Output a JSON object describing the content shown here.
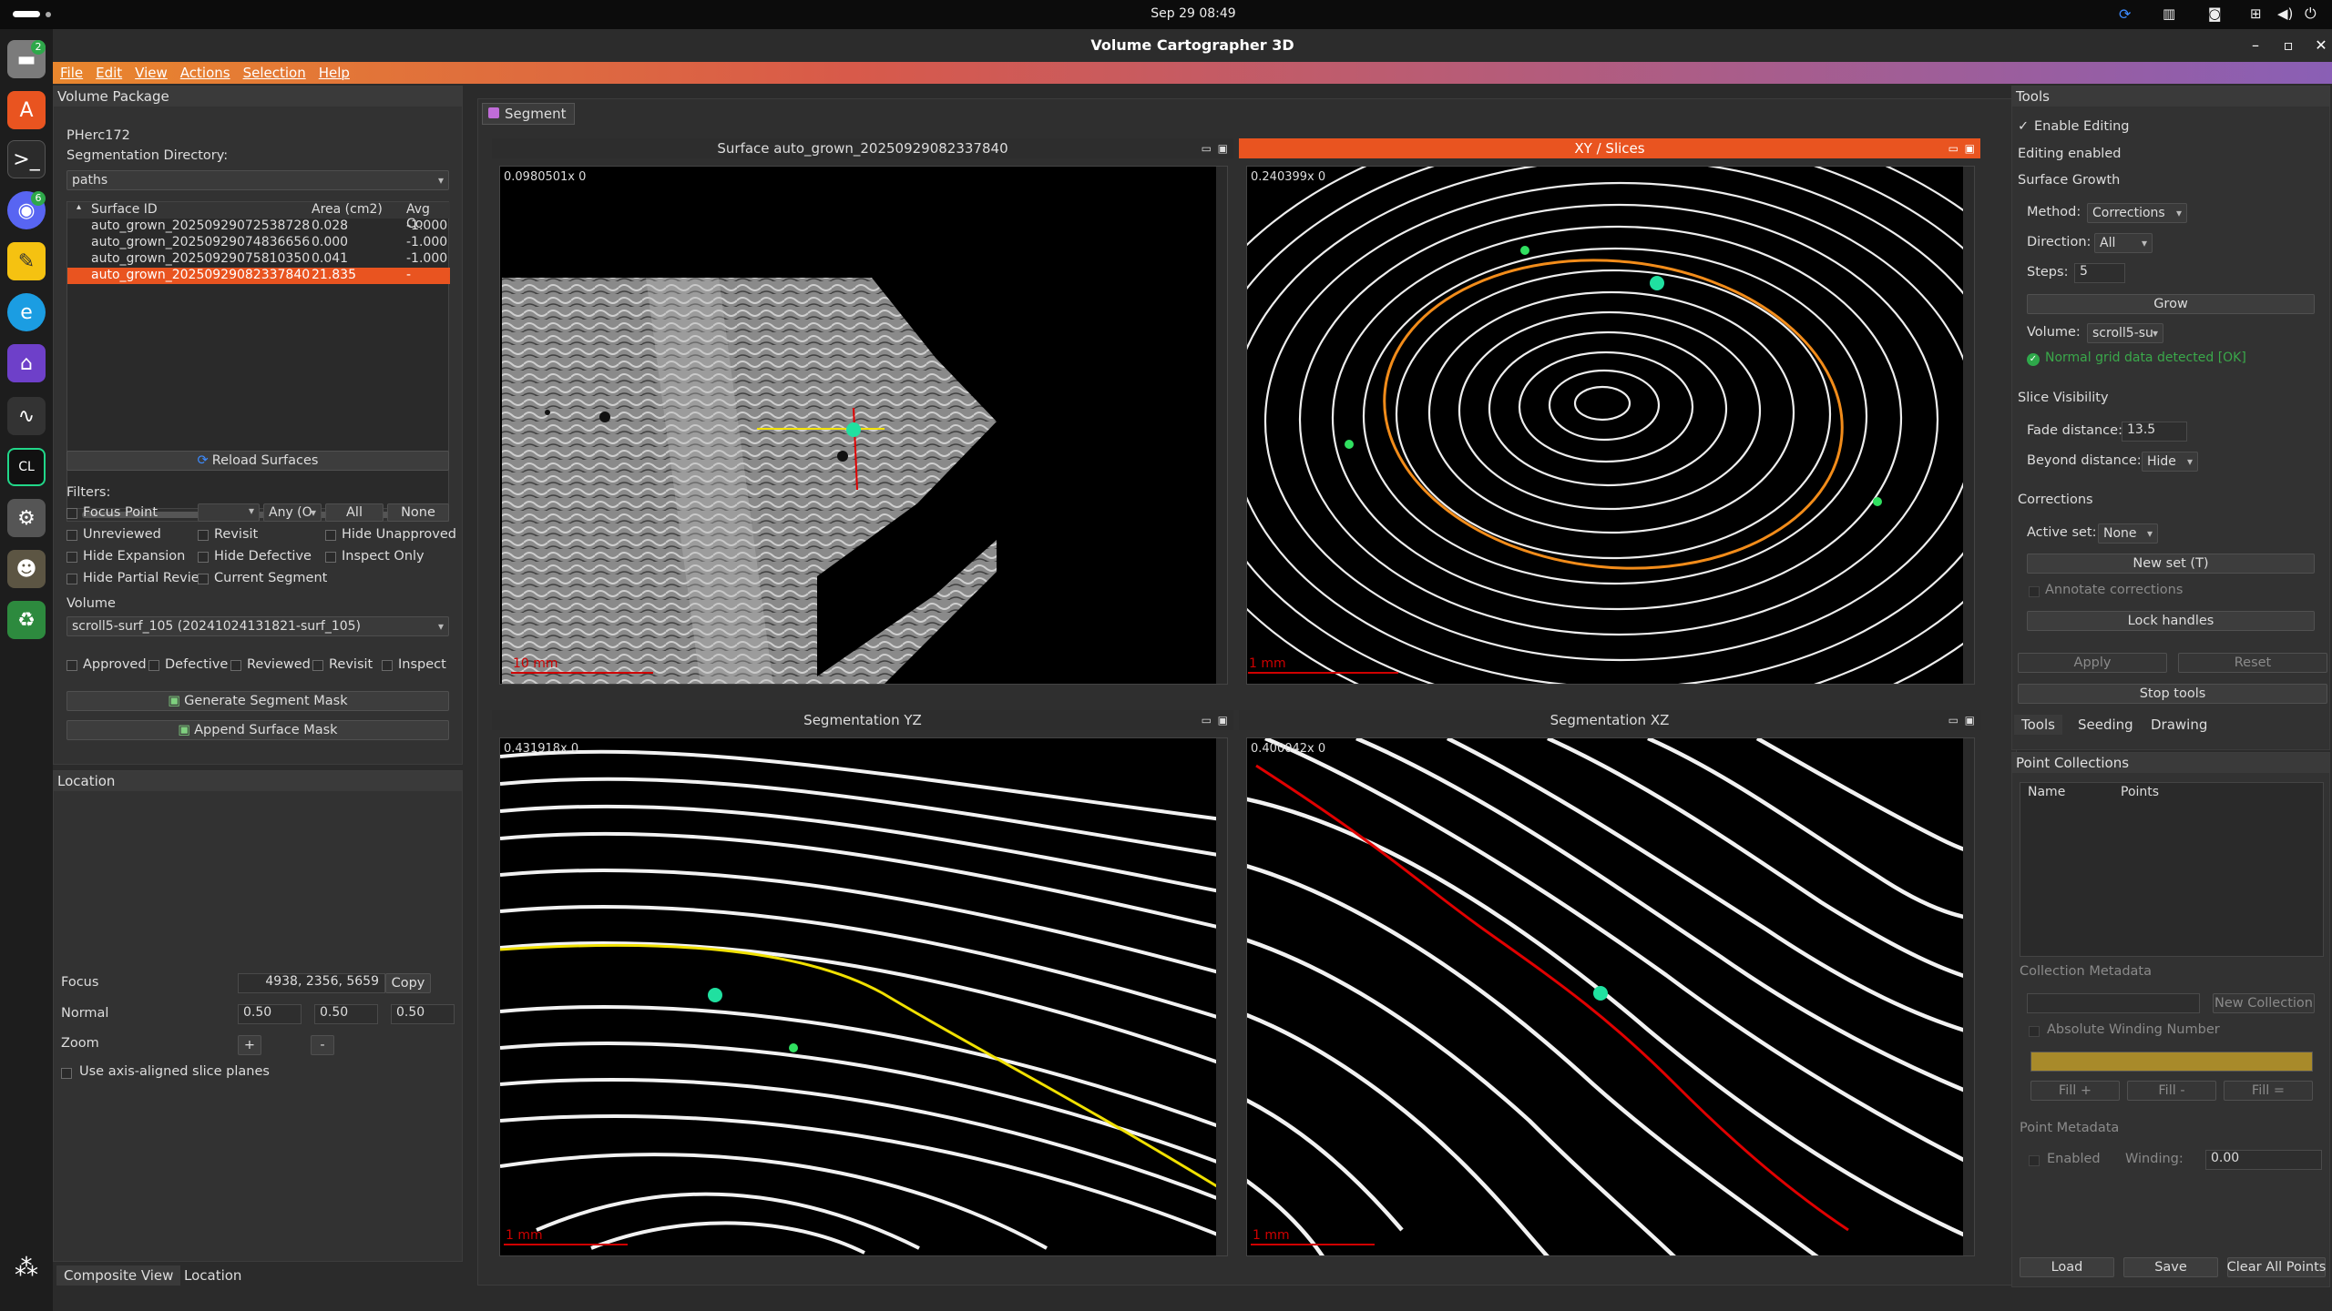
{
  "topbar": {
    "datetime": "Sep 29  08:49"
  },
  "window": {
    "title": "Volume Cartographer 3D"
  },
  "dock": {
    "badges": {
      "files": "2",
      "discord": "6"
    }
  },
  "menu": {
    "items": [
      "File",
      "Edit",
      "View",
      "Actions",
      "Selection",
      "Help"
    ]
  },
  "volume_package": {
    "title": "Volume Package",
    "package_name": "PHerc172",
    "seg_dir_label": "Segmentation Directory:",
    "seg_dir_value": "paths",
    "columns": [
      "Surface ID",
      "Area (cm2)",
      "Avg Co"
    ],
    "rows": [
      {
        "id": "auto_grown_20250929072538728",
        "area": "0.028",
        "avg": "-1.000"
      },
      {
        "id": "auto_grown_20250929074836656",
        "area": "0.000",
        "avg": "-1.000"
      },
      {
        "id": "auto_grown_20250929075810350",
        "area": "0.041",
        "avg": "-1.000"
      },
      {
        "id": "auto_grown_20250929082337840",
        "area": "21.835",
        "avg": "-"
      }
    ],
    "reload": "Reload Surfaces",
    "filters_label": "Filters:",
    "focus_point": "Focus Point",
    "any_combo": "Any (O",
    "all_btn": "All",
    "none_btn": "None",
    "unreviewed": "Unreviewed",
    "revisit": "Revisit",
    "hide_unapproved": "Hide Unapproved",
    "hide_expansion": "Hide Expansion",
    "hide_defective": "Hide Defective",
    "inspect_only": "Inspect Only",
    "hide_partial": "Hide Partial Revie",
    "current_segment": "Current Segment",
    "volume_label": "Volume",
    "volume_value": "scroll5-surf_105 (20241024131821-surf_105)",
    "tags": [
      "Approved",
      "Defective",
      "Reviewed",
      "Revisit",
      "Inspect"
    ],
    "gen_mask": "Generate Segment Mask",
    "append_mask": "Append Surface Mask"
  },
  "location": {
    "title": "Location",
    "focus_label": "Focus",
    "focus_value": "4938, 2356, 5659",
    "copy": "Copy",
    "normal_label": "Normal",
    "normal": [
      "0.50",
      "0.50",
      "0.50"
    ],
    "zoom_label": "Zoom",
    "zoom_plus": "+",
    "zoom_minus": "-",
    "axis_aligned": "Use axis-aligned slice planes"
  },
  "bottom_tabs": [
    "Composite View",
    "Location"
  ],
  "segment_tab": "Segment",
  "views": {
    "surface": {
      "title": "Surface auto_grown_20250929082337840",
      "overlay": "0.0980501x 0",
      "scale": "10 mm"
    },
    "xy": {
      "title": "XY / Slices",
      "overlay": "0.240399x 0",
      "scale": "1 mm"
    },
    "yz": {
      "title": "Segmentation YZ",
      "overlay": "0.431918x 0",
      "scale": "1 mm"
    },
    "xz": {
      "title": "Segmentation XZ",
      "overlay": "0.400042x 0",
      "scale": "1 mm"
    }
  },
  "tools": {
    "title": "Tools",
    "enable_editing": "Enable Editing",
    "editing_enabled": "Editing enabled",
    "surface_growth": "Surface Growth",
    "method_label": "Method:",
    "method": "Corrections",
    "direction_label": "Direction:",
    "direction": "All",
    "steps_label": "Steps:",
    "steps": "5",
    "grow": "Grow",
    "volume_label": "Volume:",
    "volume": "scroll5-su",
    "normal_grid": "Normal grid data detected [OK]",
    "slice_visibility": "Slice Visibility",
    "fade_label": "Fade distance:",
    "fade": "13.5",
    "beyond_label": "Beyond distance:",
    "beyond": "Hide",
    "corrections": "Corrections",
    "active_set_label": "Active set:",
    "active_set": "None",
    "new_set": "New set (T)",
    "annotate": "Annotate corrections",
    "lock_handles": "Lock handles",
    "apply": "Apply",
    "reset": "Reset",
    "stop_tools": "Stop tools",
    "tabs": [
      "Tools",
      "Seeding",
      "Drawing"
    ]
  },
  "points": {
    "title": "Point Collections",
    "columns": [
      "Name",
      "Points"
    ],
    "collection_metadata": "Collection Metadata",
    "new_collection": "New Collection",
    "absolute_winding": "Absolute Winding Number",
    "fill_plus": "Fill +",
    "fill_minus": "Fill -",
    "fill_eq": "Fill =",
    "point_metadata": "Point Metadata",
    "enabled": "Enabled",
    "winding_label": "Winding:",
    "winding": "0.00",
    "load": "Load",
    "save": "Save",
    "clear": "Clear All Points"
  }
}
